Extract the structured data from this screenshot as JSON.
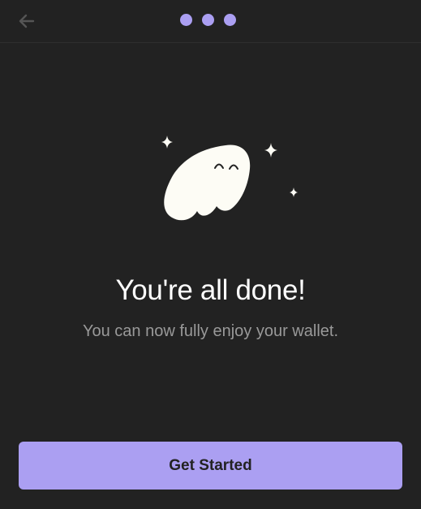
{
  "header": {
    "back_icon": "arrow-left-icon",
    "steps": {
      "total": 3,
      "current": 3
    }
  },
  "illustration": {
    "icon": "ghost-mascot-icon",
    "sparkles": [
      "sparkle-icon",
      "sparkle-icon",
      "sparkle-icon"
    ]
  },
  "main": {
    "title": "You're all done!",
    "subtitle": "You can now fully enjoy your wallet."
  },
  "footer": {
    "button_label": "Get Started"
  },
  "colors": {
    "background": "#222222",
    "accent": "#ab9ff2",
    "title_text": "#ffffff",
    "subtitle_text": "#999999",
    "back_icon": "#555555",
    "ghost": "#fdfcf5",
    "button_text": "#222222"
  }
}
